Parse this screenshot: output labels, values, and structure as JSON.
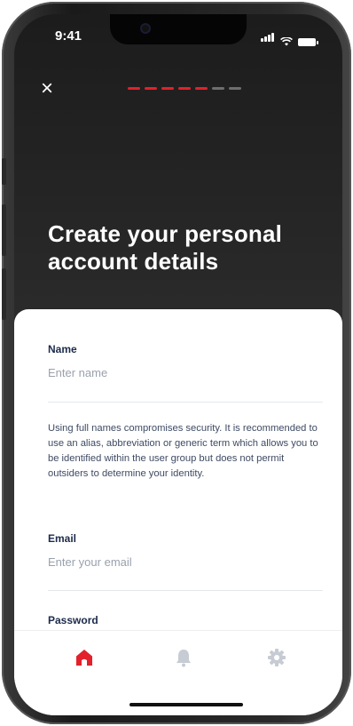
{
  "status_bar": {
    "time": "9:41"
  },
  "header": {
    "close_label": "×",
    "progress": {
      "completed_steps": 5,
      "total_steps": 7
    },
    "title": "Create your personal account details"
  },
  "form": {
    "name": {
      "label": "Name",
      "placeholder": "Enter name",
      "helper": "Using full names compromises security. It is recommended to use an alias, abbreviation or generic term which allows you to be identified within the user group but does not permit outsiders to determine your identity."
    },
    "email": {
      "label": "Email",
      "placeholder": "Enter your email"
    },
    "password": {
      "label": "Password"
    }
  },
  "tab_bar": {
    "tabs": [
      {
        "icon": "home-icon",
        "active": true
      },
      {
        "icon": "bell-icon",
        "active": false
      },
      {
        "icon": "gear-icon",
        "active": false
      }
    ]
  },
  "colors": {
    "accent": "#e2212b",
    "inactive": "#c7cbd3",
    "text_dark": "#1c2a4a"
  }
}
